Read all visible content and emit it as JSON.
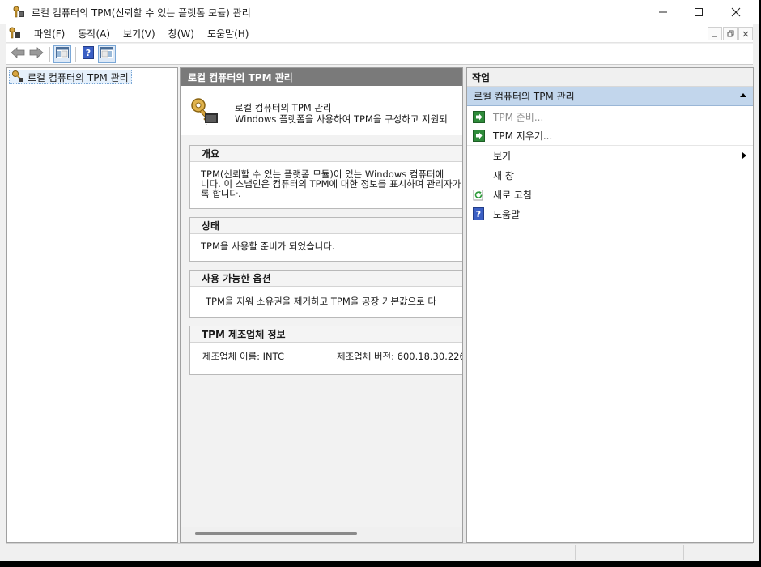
{
  "window": {
    "title": "로컬 컴퓨터의 TPM(신뢰할 수 있는 플랫폼 모듈) 관리",
    "app_icon": "tpm-key-chip-icon"
  },
  "menu": {
    "items": [
      "파일(F)",
      "동작(A)",
      "보기(V)",
      "창(W)",
      "도움말(H)"
    ]
  },
  "toolbar": {
    "buttons": [
      "back-arrow-icon",
      "forward-arrow-icon",
      "show-hide-console-tree-icon",
      "help-icon",
      "show-hide-action-pane-icon"
    ]
  },
  "tree": {
    "root_label": "로컬 컴퓨터의 TPM 관리"
  },
  "center": {
    "header": "로컬 컴퓨터의 TPM 관리",
    "banner_title": "로컬 컴퓨터의 TPM 관리",
    "banner_desc": "Windows 플랫폼을 사용하여 TPM을 구성하고 지원되",
    "sections": {
      "overview": {
        "title": "개요",
        "line1": "TPM(신뢰할 수 있는 플랫폼 모듈)이 있는 Windows 컴퓨터에",
        "line2": "니다. 이 스냅인은 컴퓨터의 TPM에 대한 정보를 표시하며 관리자가",
        "line3": "록 합니다."
      },
      "status": {
        "title": "상태",
        "text": "TPM을 사용할 준비가 되었습니다."
      },
      "options": {
        "title": "사용 가능한 옵션",
        "text": "TPM을 지워 소유권을 제거하고 TPM을 공장 기본값으로 다"
      },
      "manufacturer": {
        "title": "TPM 제조업체 정보",
        "name_label": "제조업체 이름: INTC",
        "version_label": "제조업체 버전: 600.18.30.226"
      }
    }
  },
  "actions": {
    "title": "작업",
    "group_label": "로컬 컴퓨터의 TPM 관리",
    "items": {
      "prepare": "TPM 준비...",
      "clear": "TPM 지우기...",
      "view": "보기",
      "new_window": "새 창",
      "refresh": "새로 고침",
      "help": "도움말"
    }
  },
  "colors": {
    "selected_group": "#c2d6ec",
    "pane_header": "#7a7a7a",
    "disabled_text": "#8d8d8d"
  }
}
